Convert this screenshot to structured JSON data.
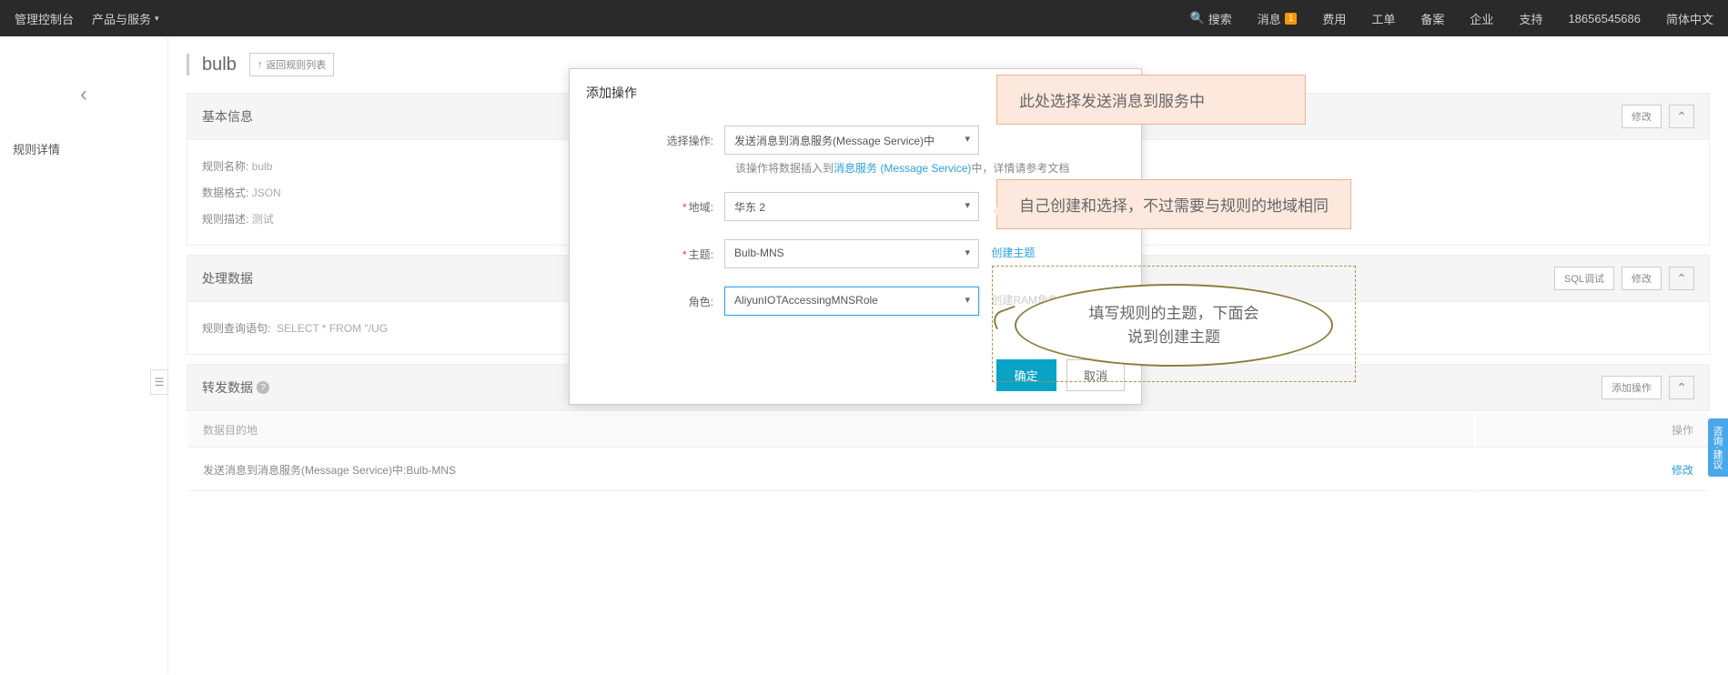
{
  "topnav": {
    "console": "管理控制台",
    "products": "产品与服务",
    "search": "搜索",
    "messages": "消息",
    "badge": "1",
    "fees": "费用",
    "tickets": "工单",
    "filing": "备案",
    "enterprise": "企业",
    "support": "支持",
    "account": "18656545686",
    "lang": "简体中文"
  },
  "sidenav": {
    "item1": "规则详情"
  },
  "header": {
    "title": "bulb",
    "back": "返回规则列表"
  },
  "basic": {
    "title": "基本信息",
    "modify": "修改",
    "rule_name_label": "规则名称:",
    "rule_name": "bulb",
    "format_label": "数据格式:",
    "format": "JSON",
    "desc_label": "规则描述:",
    "desc": "测试"
  },
  "process": {
    "title": "处理数据",
    "sql_debug": "SQL调试",
    "modify": "修改",
    "query_label": "规则查询语句:",
    "query": "SELECT * FROM \"/UG"
  },
  "forward": {
    "title": "转发数据",
    "add_action": "添加操作",
    "col_dest": "数据目的地",
    "col_action": "操作",
    "row_dest": "发送消息到消息服务(Message Service)中:Bulb-MNS",
    "row_action": "修改"
  },
  "modal": {
    "title": "添加操作",
    "op_label": "选择操作:",
    "op_value": "发送消息到消息服务(Message Service)中",
    "desc_prefix": "该操作将数据插入到",
    "desc_link": "消息服务 (Message Service)",
    "desc_suffix": "中，详情请参考文档",
    "region_label": "地域:",
    "region_value": "华东 2",
    "topic_label": "主题:",
    "topic_value": "Bulb-MNS",
    "topic_create": "创建主题",
    "role_label": "角色:",
    "role_value": "AliyunIOTAccessingMNSRole",
    "role_create": "创建RAM角色",
    "ok": "确定",
    "cancel": "取消"
  },
  "annotations": {
    "a1": "此处选择发送消息到服务中",
    "a2": "自己创建和选择，不过需要与规则的地域相同",
    "a3_l1": "填写规则的主题，下面会",
    "a3_l2": "说到创建主题"
  },
  "float": "咨询·建议"
}
